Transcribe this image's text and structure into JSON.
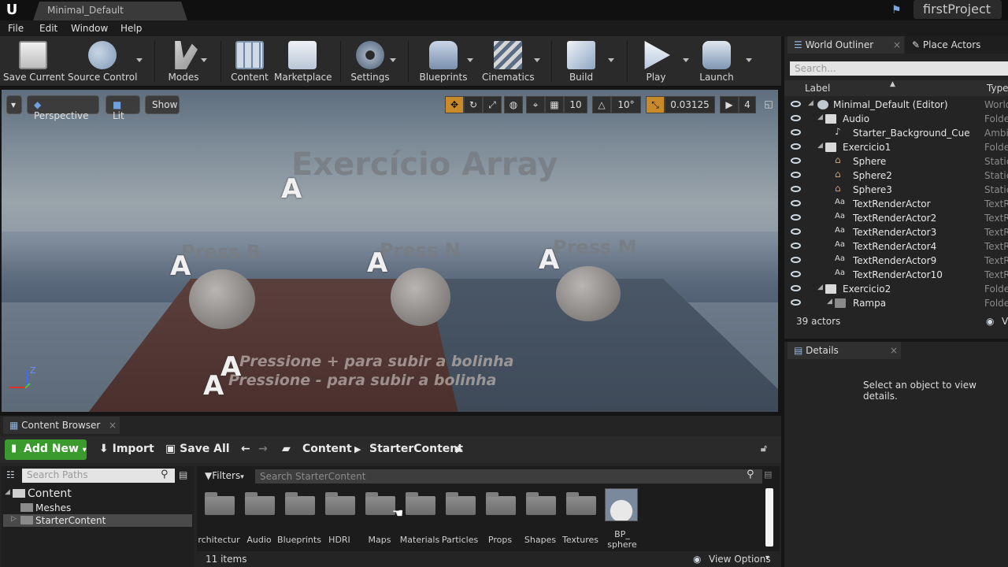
{
  "window": {
    "doc_tab": "Minimal_Default",
    "project": "firstProject"
  },
  "menu": [
    "File",
    "Edit",
    "Window",
    "Help"
  ],
  "toolbar": {
    "save_current": "Save Current",
    "source_control": "Source Control",
    "modes": "Modes",
    "content": "Content",
    "marketplace": "Marketplace",
    "settings": "Settings",
    "blueprints": "Blueprints",
    "cinematics": "Cinematics",
    "build": "Build",
    "play": "Play",
    "launch": "Launch"
  },
  "viewport": {
    "perspective": "Perspective",
    "lit": "Lit",
    "show": "Show",
    "grid_snap": "10",
    "rotation_snap": "10°",
    "scale_snap": "0.03125",
    "camera_speed": "4",
    "scene_title": "Exercício Array",
    "press_b": "Press B",
    "press_n": "Press N",
    "press_m": "Press M",
    "line_plus": "Pressione + para subir a bolinha",
    "line_minus": "Pressione - para subir a bolinha",
    "axis_z": "Z"
  },
  "outliner": {
    "tab_world": "World Outliner",
    "tab_place": "Place Actors",
    "search_placeholder": "Search...",
    "col_label": "Label",
    "col_type": "Type",
    "rows": [
      {
        "label": "Minimal_Default (Editor)",
        "type": "World"
      },
      {
        "label": "Audio",
        "type": "Folder"
      },
      {
        "label": "Starter_Background_Cue",
        "type": "Ambie"
      },
      {
        "label": "Exercicio1",
        "type": "Folder"
      },
      {
        "label": "Sphere",
        "type": "Static"
      },
      {
        "label": "Sphere2",
        "type": "Static"
      },
      {
        "label": "Sphere3",
        "type": "Static"
      },
      {
        "label": "TextRenderActor",
        "type": "TextR"
      },
      {
        "label": "TextRenderActor2",
        "type": "TextR"
      },
      {
        "label": "TextRenderActor3",
        "type": "TextR"
      },
      {
        "label": "TextRenderActor4",
        "type": "TextR"
      },
      {
        "label": "TextRenderActor9",
        "type": "TextR"
      },
      {
        "label": "TextRenderActor10",
        "type": "TextR"
      },
      {
        "label": "Exercicio2",
        "type": "Folder"
      },
      {
        "label": "Rampa",
        "type": "Folder"
      }
    ],
    "actor_count": "39 actors",
    "view_options_short": "V"
  },
  "details": {
    "tab": "Details",
    "empty_message": "Select an object to view details."
  },
  "content_browser": {
    "tab": "Content Browser",
    "add_new": "Add New",
    "import": "Import",
    "save_all": "Save All",
    "crumb_content": "Content",
    "crumb_starter": "StarterContent",
    "search_paths": "Search Paths",
    "filters": "Filters",
    "search_assets": "Search StarterContent",
    "tree": [
      "Content",
      "Meshes",
      "StarterContent"
    ],
    "assets": [
      "rchitectur",
      "Audio",
      "Blueprints",
      "HDRI",
      "Maps",
      "Materials",
      "Particles",
      "Props",
      "Shapes",
      "Textures"
    ],
    "bp_asset": "BP_",
    "bp_asset_line2": "sphere",
    "item_count": "11 items",
    "view_options": "View Options"
  }
}
